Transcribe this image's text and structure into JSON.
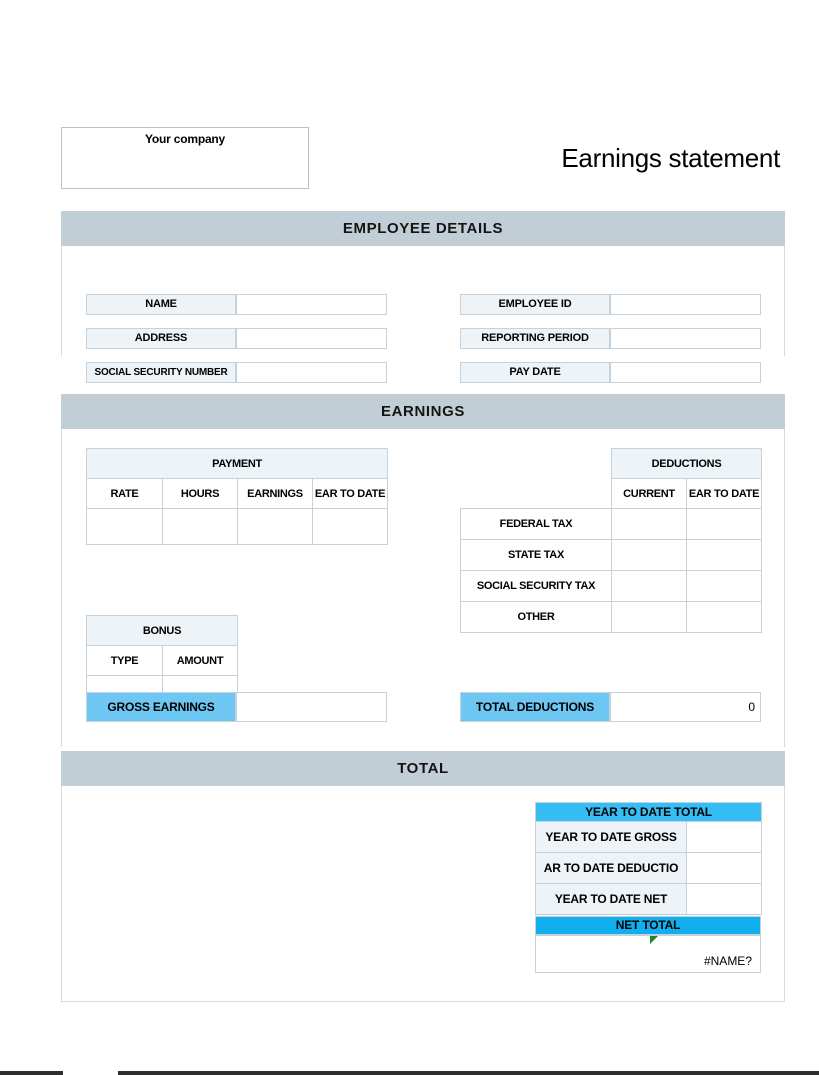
{
  "header": {
    "company_name": "Your company",
    "doc_title": "Earnings statement"
  },
  "sections": {
    "employee_details": "EMPLOYEE DETAILS",
    "earnings": "EARNINGS",
    "total": "TOTAL"
  },
  "employee_details": {
    "left": [
      {
        "label": "NAME",
        "value": ""
      },
      {
        "label": "ADDRESS",
        "value": ""
      },
      {
        "label": "SOCIAL SECURITY NUMBER",
        "value": ""
      }
    ],
    "right": [
      {
        "label": "EMPLOYEE ID",
        "value": ""
      },
      {
        "label": "REPORTING PERIOD",
        "value": ""
      },
      {
        "label": "PAY DATE",
        "value": ""
      }
    ]
  },
  "payment_table": {
    "caption": "PAYMENT",
    "columns": [
      "RATE",
      "HOURS",
      "EARNINGS",
      "EAR TO DATE"
    ],
    "rows": [
      [
        "",
        "",
        "",
        ""
      ]
    ]
  },
  "deductions_table": {
    "caption": "DEDUCTIONS",
    "columns": [
      "CURRENT",
      "EAR TO DATE"
    ],
    "rows": [
      {
        "label": "FEDERAL TAX",
        "current": "",
        "year_to_date": ""
      },
      {
        "label": "STATE TAX",
        "current": "",
        "year_to_date": ""
      },
      {
        "label": "SOCIAL SECURITY TAX",
        "current": "",
        "year_to_date": ""
      },
      {
        "label": "OTHER",
        "current": "",
        "year_to_date": ""
      }
    ]
  },
  "bonus_table": {
    "caption": "BONUS",
    "columns": [
      "TYPE",
      "AMOUNT"
    ],
    "rows": [
      [
        "",
        ""
      ]
    ]
  },
  "gross_earnings": {
    "label": "GROSS EARNINGS",
    "value": ""
  },
  "total_deductions": {
    "label": "TOTAL DEDUCTIONS",
    "value": "0"
  },
  "year_to_date_total": {
    "caption": "YEAR TO DATE TOTAL",
    "rows": [
      {
        "label": "YEAR TO DATE GROSS",
        "value": ""
      },
      {
        "label": "AR TO DATE DEDUCTIO",
        "value": ""
      },
      {
        "label": "YEAR TO DATE NET",
        "value": ""
      }
    ]
  },
  "net_total": {
    "label": "NET TOTAL",
    "value": "#NAME?",
    "error_marker": "error-triangle-icon"
  },
  "colors": {
    "band": "#c2ced6",
    "label_cell": "#edf3f7",
    "highlight_light": "#6ec6f2",
    "highlight_mid": "#35bdf5",
    "highlight_strong": "#12aff0",
    "error_marker": "#1a8b2a",
    "border": "#c5d2dc"
  }
}
